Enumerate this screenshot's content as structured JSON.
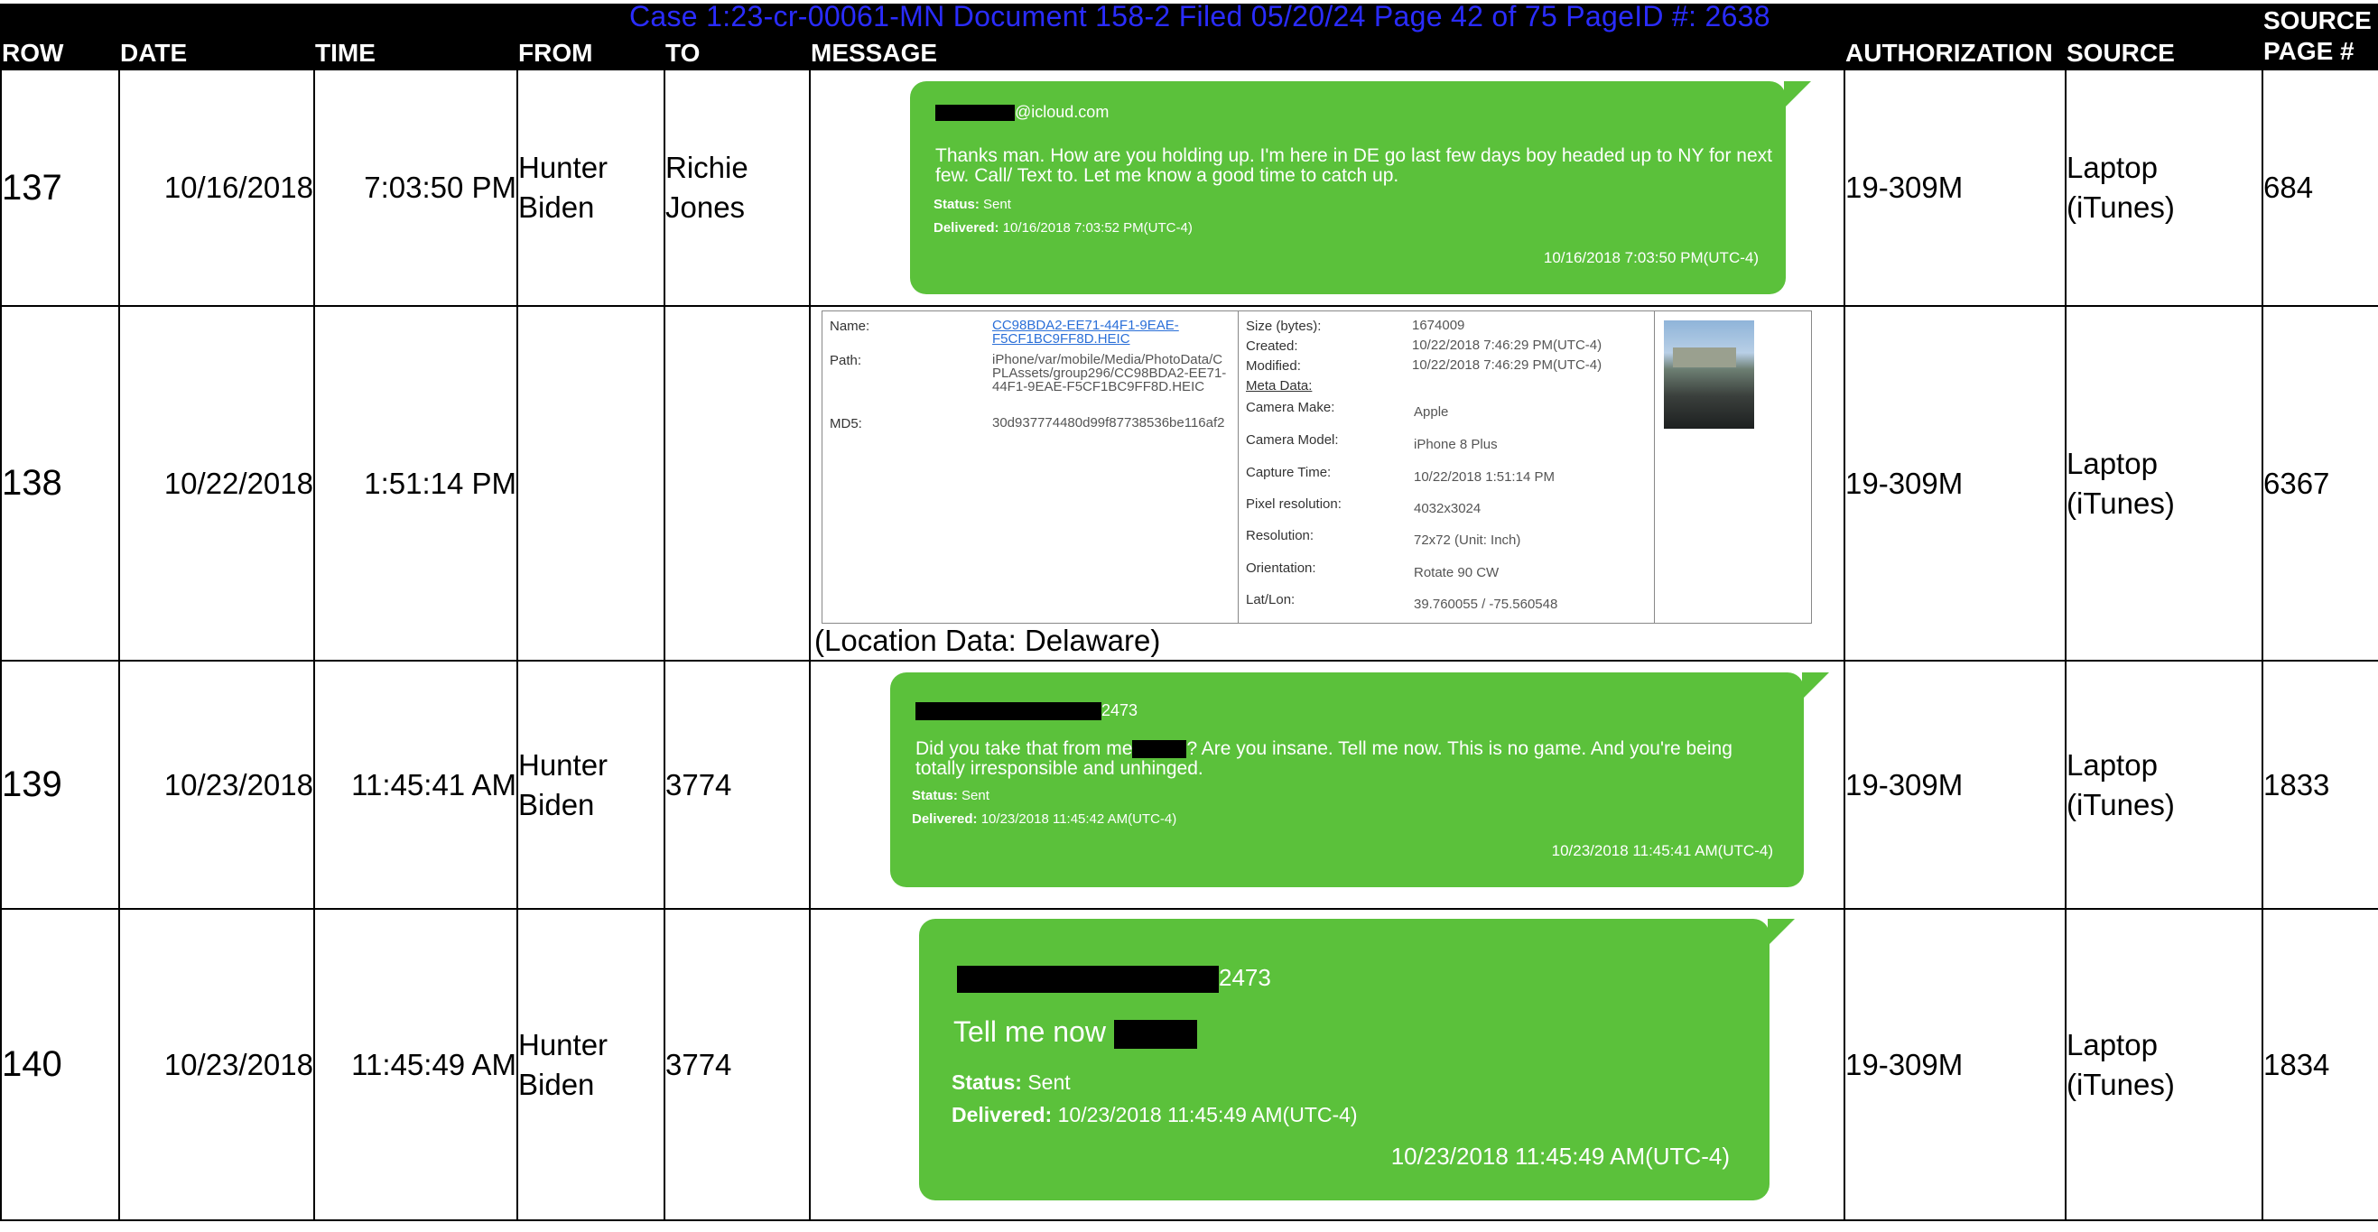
{
  "watermark": "Case 1:23-cr-00061-MN   Document 158-2   Filed 05/20/24   Page 42 of 75 PageID #: 2638",
  "headers": {
    "row": "ROW",
    "date": "DATE",
    "time": "TIME",
    "from": "FROM",
    "to": "TO",
    "message": "MESSAGE",
    "authorization": "AUTHORIZATION",
    "source": "SOURCE",
    "source_page_1": "SOURCE",
    "source_page_2": "PAGE #"
  },
  "rows": [
    {
      "row": "137",
      "date": "10/16/2018",
      "time": "7:03:50 PM",
      "from_1": "Hunter",
      "from_2": "Biden",
      "to_1": "Richie",
      "to_2": "Jones",
      "authorization": "19-309M",
      "source_1": "Laptop",
      "source_2": "(iTunes)",
      "page": "684",
      "bubble": {
        "sender_suffix": "@icloud.com",
        "body": "Thanks man. How are you holding up. I'm here in DE go last few days boy headed up to NY for next few. Call/ Text to. Let me know a good time to catch up.",
        "status_label": "Status:",
        "status": "Sent",
        "delivered_label": "Delivered:",
        "delivered": "10/16/2018 7:03:52 PM(UTC-4)",
        "timestamp": "10/16/2018 7:03:50 PM(UTC-4)"
      }
    },
    {
      "row": "138",
      "date": "10/22/2018",
      "time": "1:51:14 PM",
      "authorization": "19-309M",
      "source_1": "Laptop",
      "source_2": "(iTunes)",
      "page": "6367",
      "file": {
        "name_label": "Name:",
        "name": "CC98BDA2-EE71-44F1-9EAE-F5CF1BC9FF8D.HEIC",
        "path_label": "Path:",
        "path": "iPhone/var/mobile/Media/PhotoData/CPLAssets/group296/CC98BDA2-EE71-44F1-9EAE-F5CF1BC9FF8D.HEIC",
        "md5_label": "MD5:",
        "md5": "30d937774480d99f87738536be116af2",
        "size_label": "Size (bytes):",
        "size": "1674009",
        "created_label": "Created:",
        "created": "10/22/2018 7:46:29 PM(UTC-4)",
        "modified_label": "Modified:",
        "modified": "10/22/2018 7:46:29 PM(UTC-4)",
        "meta_label": "Meta Data:",
        "make_label": "Camera Make:",
        "make": "Apple",
        "model_label": "Camera Model:",
        "model": "iPhone 8 Plus",
        "capture_label": "Capture Time:",
        "capture": "10/22/2018 1:51:14 PM",
        "pixel_label": "Pixel resolution:",
        "pixel": "4032x3024",
        "res_label": "Resolution:",
        "res": "72x72 (Unit: Inch)",
        "orient_label": "Orientation:",
        "orient": "Rotate 90 CW",
        "latlon_label": "Lat/Lon:",
        "latlon": "39.760055 / -75.560548"
      },
      "caption": "(Location Data: Delaware)"
    },
    {
      "row": "139",
      "date": "10/23/2018",
      "time": "11:45:41 AM",
      "from_1": "Hunter",
      "from_2": "Biden",
      "to_1": "3774",
      "authorization": "19-309M",
      "source_1": "Laptop",
      "source_2": "(iTunes)",
      "page": "1833",
      "bubble": {
        "sender_suffix": "2473",
        "body_a": "Did you take that from me",
        "body_b": "? Are you insane. Tell me now. This is no game. And you're being totally irresponsible and unhinged.",
        "status_label": "Status:",
        "status": "Sent",
        "delivered_label": "Delivered:",
        "delivered": "10/23/2018 11:45:42 AM(UTC-4)",
        "timestamp": "10/23/2018 11:45:41 AM(UTC-4)"
      }
    },
    {
      "row": "140",
      "date": "10/23/2018",
      "time": "11:45:49 AM",
      "from_1": "Hunter",
      "from_2": "Biden",
      "to_1": "3774",
      "authorization": "19-309M",
      "source_1": "Laptop",
      "source_2": "(iTunes)",
      "page": "1834",
      "bubble": {
        "sender_suffix": "2473",
        "body": "Tell me now",
        "status_label": "Status:",
        "status": "Sent",
        "delivered_label": "Delivered:",
        "delivered": "10/23/2018 11:45:49 AM(UTC-4)",
        "timestamp": "10/23/2018 11:45:49 AM(UTC-4)"
      }
    }
  ]
}
